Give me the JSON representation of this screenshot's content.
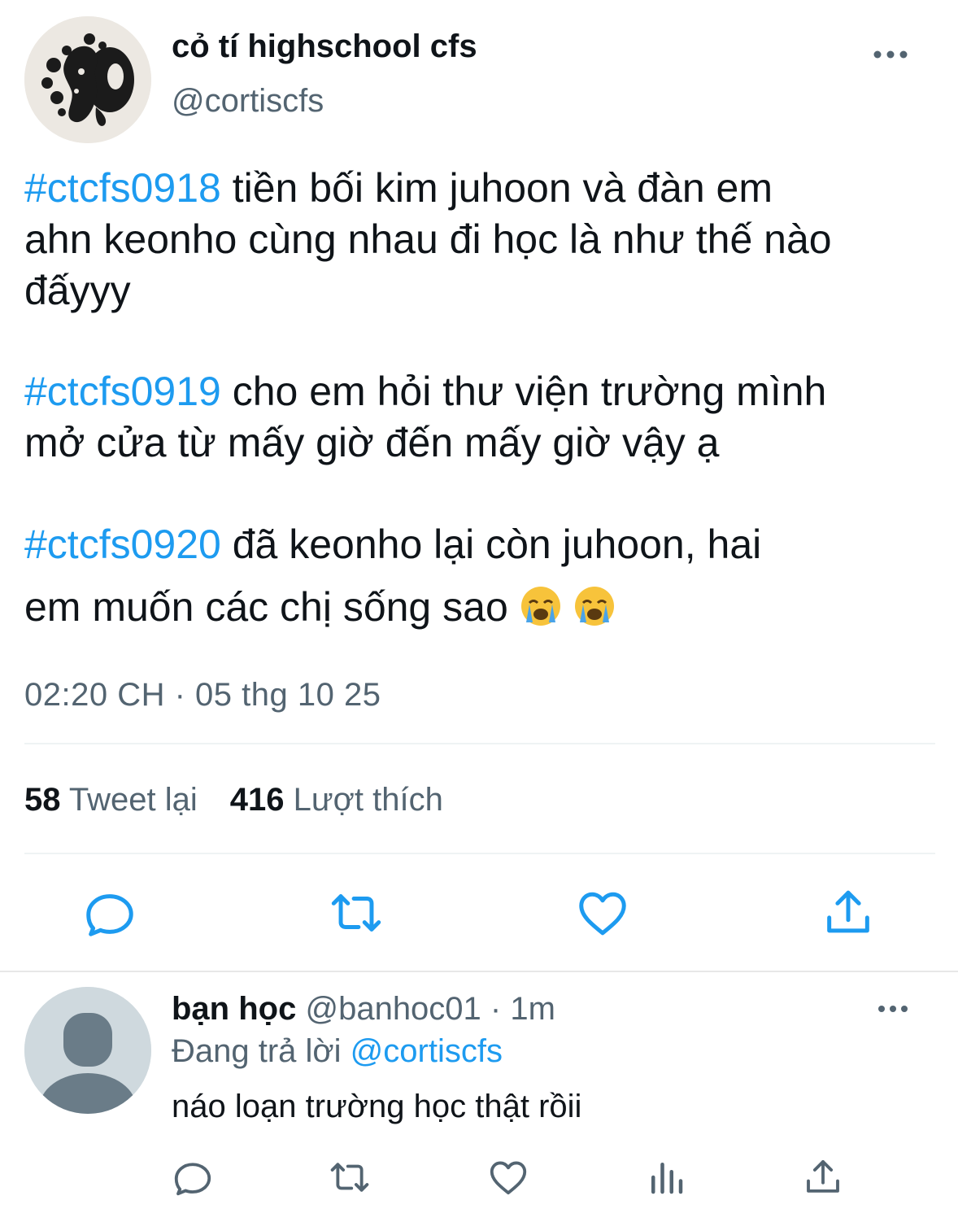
{
  "tweet": {
    "author": {
      "display_name": "cỏ tí highschool cfs",
      "handle": "@cortiscfs",
      "avatar_icon": "ink-splash-avatar"
    },
    "paragraphs": [
      {
        "hashtag": "#ctcfs0918",
        "line1": " tiền bối kim juhoon và đàn em",
        "line2": "ahn keonho cùng nhau đi học là như thế nào",
        "line3": "đấyyy"
      },
      {
        "hashtag": "#ctcfs0919",
        "line1": " cho em hỏi thư viện trường mình",
        "line2": "mở cửa từ mấy giờ đến mấy giờ vậy ạ"
      },
      {
        "hashtag": "#ctcfs0920",
        "line1": " đã keonho lại còn juhoon, hai",
        "line2": "em muốn các chị sống sao",
        "emoji": "loudly-crying-face"
      }
    ],
    "timestamp": "02:20 CH · 05 thg 10 25",
    "stats": {
      "retweets": "58",
      "retweets_label": "Tweet lại",
      "likes": "416",
      "likes_label": "Lượt thích"
    },
    "actions": [
      "reply-icon",
      "retweet-icon",
      "like-icon",
      "share-icon"
    ]
  },
  "reply": {
    "display_name": "bạn học",
    "meta": "@banhoc01 · 1m",
    "replying_prefix": "Đang trả lời ",
    "replying_to": "@cortiscfs",
    "text": "náo loạn trường học thật rồii",
    "actions": [
      "reply-icon",
      "retweet-icon",
      "like-icon",
      "analytics-icon",
      "share-icon"
    ]
  },
  "colors": {
    "accent": "#1d9bf0",
    "secondary_text": "#536471",
    "icon": "#1d9bf0"
  }
}
